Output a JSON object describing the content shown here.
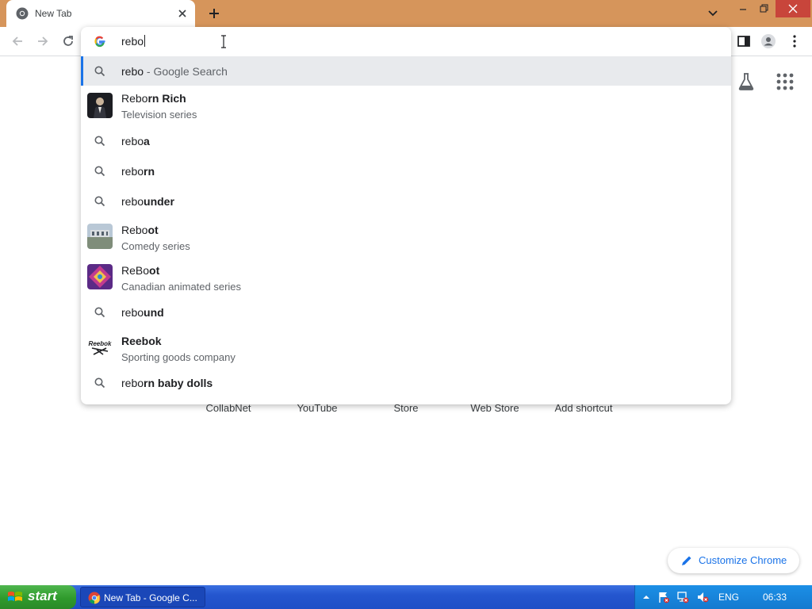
{
  "browser": {
    "tab_title": "New Tab",
    "omnibox_text": "rebo"
  },
  "suggestions": [
    {
      "type": "search",
      "typed": "rebo",
      "completion": "",
      "suffix": " - Google Search",
      "selected": true
    },
    {
      "type": "entity",
      "typed": "Rebo",
      "completion": "rn Rich",
      "subtitle": "Television series",
      "thumb": "reborn-rich-thumbnail"
    },
    {
      "type": "search",
      "typed": "rebo",
      "completion": "a"
    },
    {
      "type": "search",
      "typed": "rebo",
      "completion": "rn"
    },
    {
      "type": "search",
      "typed": "rebo",
      "completion": "under"
    },
    {
      "type": "entity",
      "typed": "Rebo",
      "completion": "ot",
      "subtitle": "Comedy series",
      "thumb": "reboot-thumbnail"
    },
    {
      "type": "entity",
      "typed": "ReBo",
      "completion": "ot",
      "subtitle": "Canadian animated series",
      "thumb": "reboot-animated-thumbnail"
    },
    {
      "type": "search",
      "typed": "rebo",
      "completion": "und"
    },
    {
      "type": "entity",
      "typed": "",
      "completion": "Reebok",
      "subtitle": "Sporting goods company",
      "thumb": "reebok-logo"
    },
    {
      "type": "search",
      "typed": "rebo",
      "completion": "rn baby dolls"
    }
  ],
  "shortcuts": [
    "CollabNet",
    "YouTube",
    "Store",
    "Web Store",
    "Add shortcut"
  ],
  "customize_label": "Customize Chrome",
  "reebok_logo_text": "Reebok",
  "taskbar": {
    "start_label": "start",
    "task_label": "New Tab - Google C...",
    "language": "ENG",
    "clock": "06:33"
  },
  "colors": {
    "title_bar": "#d6955b",
    "accent": "#1a73e8",
    "selected_row": "#e8eaed",
    "taskbar": "#2456cf",
    "start_button": "#2f9a2c"
  }
}
